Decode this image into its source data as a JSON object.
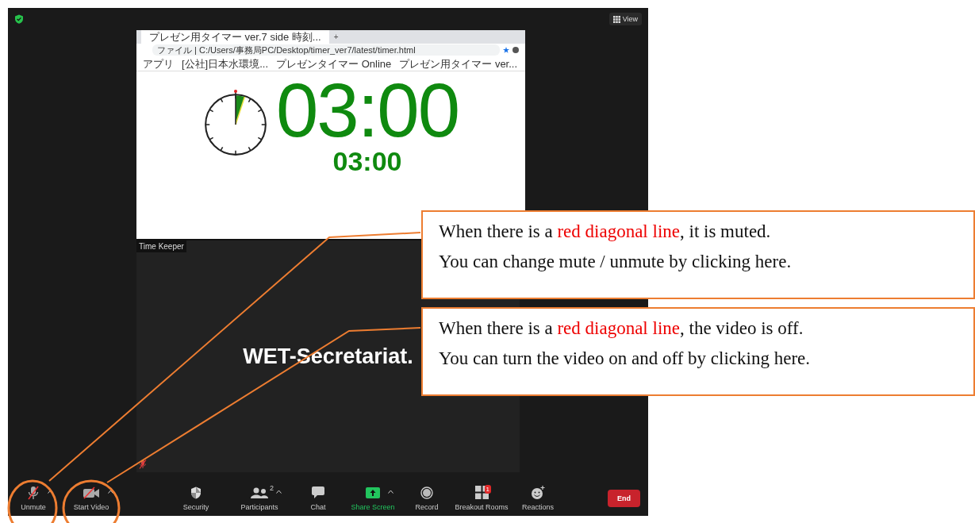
{
  "top_bar": {
    "view_label": "View"
  },
  "shared_screen": {
    "browser": {
      "tab_title": "プレゼン用タイマー ver.7 side 時刻...",
      "tab_new": "+",
      "address": "ファイル | C:/Users/事務局PC/Desktop/timer_ver7/latest/timer.html",
      "bookmarks": [
        "アプリ",
        "[公社]日本水環境...",
        "プレゼンタイマー Online",
        "プレゼン用タイマー ver..."
      ]
    },
    "timer": {
      "level": 0.05,
      "main_time": "03:00",
      "sub_time": "03:00"
    }
  },
  "video_tile": {
    "name_tag": "Time Keeper",
    "display_name": "WET-Secretariat.",
    "muted": true
  },
  "toolbar": {
    "items": [
      {
        "kind": "audio",
        "label": "Unmute",
        "muted": true,
        "caret": true
      },
      {
        "kind": "video",
        "label": "Start Video",
        "off": true,
        "caret": true
      },
      {
        "kind": "security",
        "label": "Security"
      },
      {
        "kind": "participants",
        "label": "Participants",
        "count": "2",
        "caret": true
      },
      {
        "kind": "chat",
        "label": "Chat"
      },
      {
        "kind": "share",
        "label": "Share Screen",
        "caret": true
      },
      {
        "kind": "record",
        "label": "Record"
      },
      {
        "kind": "breakout",
        "label": "Breakout Rooms",
        "badge": "1"
      },
      {
        "kind": "reactions",
        "label": "Reactions"
      }
    ],
    "end_label": "End"
  },
  "callouts": [
    {
      "lines": [
        [
          {
            "text": "When there is a "
          },
          {
            "text": "red diagonal line",
            "highlight": true
          },
          {
            "text": ", it is muted."
          }
        ],
        [
          {
            "text": "You can change mute / unmute by clicking here."
          }
        ]
      ]
    },
    {
      "lines": [
        [
          {
            "text": "When there is a "
          },
          {
            "text": "red diagonal line",
            "highlight": true
          },
          {
            "text": ", the video is off."
          }
        ],
        [
          {
            "text": "You can turn the video on and off by clicking here."
          }
        ]
      ]
    }
  ]
}
